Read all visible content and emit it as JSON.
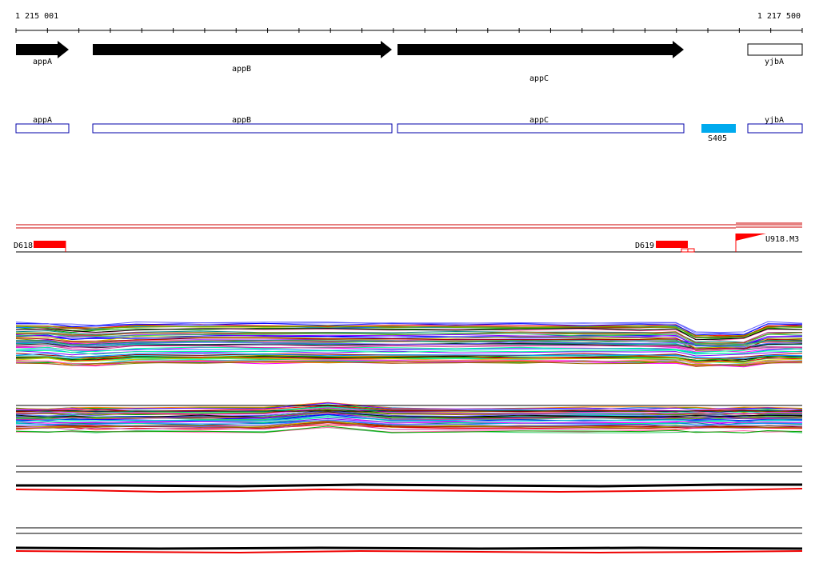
{
  "ruler": {
    "start_label": "1 215 001",
    "end_label": "1 217 500"
  },
  "genes": [
    {
      "name": "appA",
      "strand": "+",
      "style": "filled"
    },
    {
      "name": "appB",
      "strand": "+",
      "style": "filled"
    },
    {
      "name": "appC",
      "strand": "+",
      "style": "filled"
    },
    {
      "name": "yjbA",
      "strand": "+",
      "style": "outline"
    }
  ],
  "gene_boxes": [
    {
      "name": "appA"
    },
    {
      "name": "appB"
    },
    {
      "name": "appC"
    },
    {
      "name": "yjbA"
    }
  ],
  "feature": {
    "name": "S405",
    "color": "#00aaee"
  },
  "features_red": [
    {
      "name": "D618",
      "color": "#ff0000"
    },
    {
      "name": "D619",
      "color": "#ff0000"
    },
    {
      "name": "U918.M3",
      "color": "#ff0000"
    }
  ],
  "colors": {
    "accent_red": "#ff0000",
    "gene_outline": "#0000aa",
    "feature_blue": "#00aaee",
    "axis": "#000000"
  }
}
